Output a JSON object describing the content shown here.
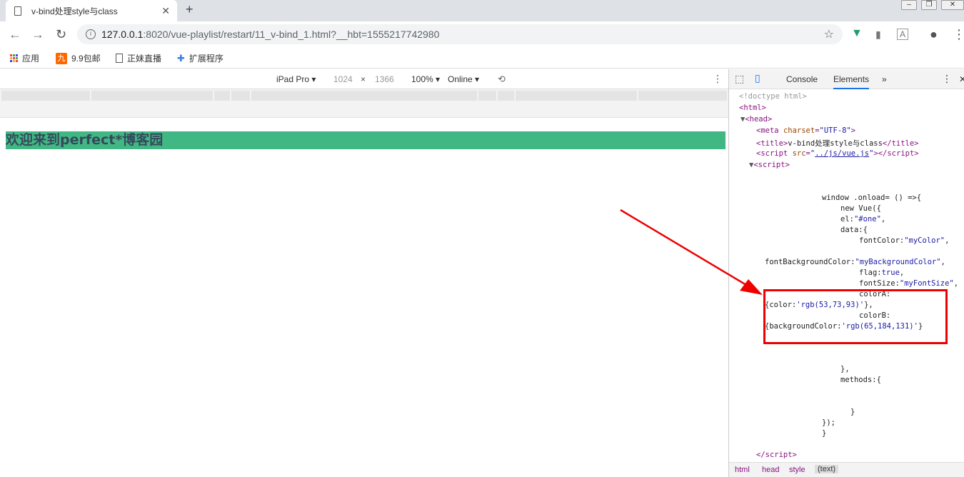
{
  "browser": {
    "tab_title": "v-bind处理style与class",
    "url_host": "127.0.0.1",
    "url_path": ":8020/vue-playlist/restart/11_v-bind_1.html?__hbt=1555217742980",
    "bookmarks": [
      {
        "label": "应用",
        "icon": "apps-grid-icon"
      },
      {
        "label": "9.9包邮",
        "icon": "jiu-logo-icon"
      },
      {
        "label": "正妹直播",
        "icon": "page-icon"
      },
      {
        "label": "扩展程序",
        "icon": "puzzle-icon"
      }
    ]
  },
  "device_toolbar": {
    "device": "iPad Pro",
    "width": "1024",
    "times": "×",
    "height": "1366",
    "zoom": "100%",
    "network": "Online"
  },
  "page": {
    "greeting": "欢迎来到perfect*博客园"
  },
  "devtools": {
    "tabs": [
      "Console",
      "Elements"
    ],
    "more": "»",
    "breadcrumbs": [
      "html",
      "head",
      "style",
      "(text)"
    ]
  },
  "colors": {
    "greeting_bg": "#41b883",
    "greeting_text": "#35495d",
    "annotation": "#e00000"
  }
}
